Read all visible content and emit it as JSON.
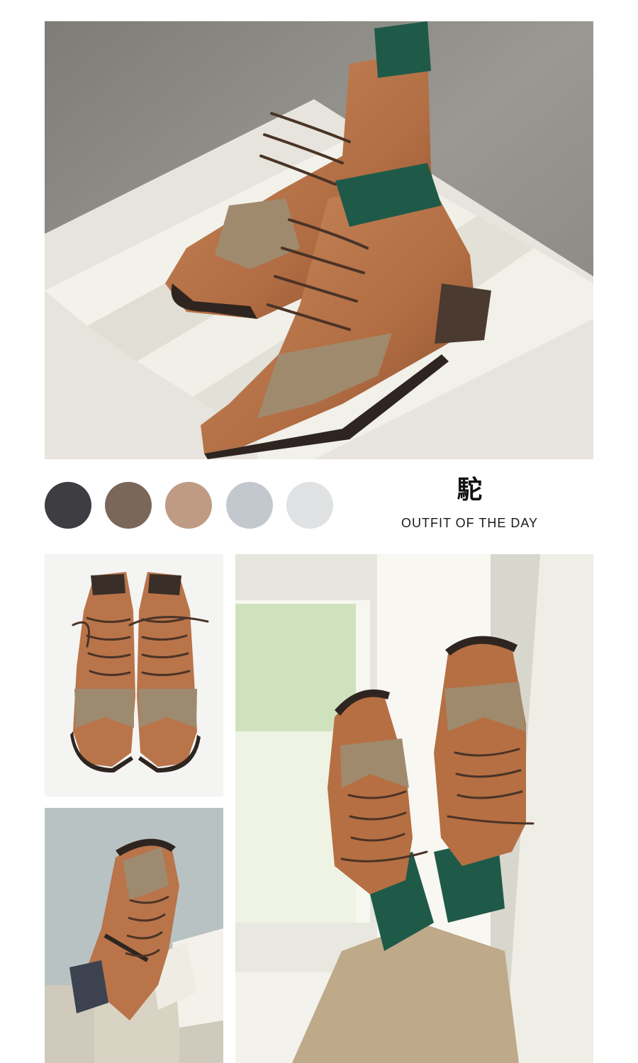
{
  "palette": {
    "swatches": [
      {
        "name": "charcoal",
        "color": "#3e3e42"
      },
      {
        "name": "mocha",
        "color": "#7b6759"
      },
      {
        "name": "tan",
        "color": "#bf9b84"
      },
      {
        "name": "cool-gray",
        "color": "#c3c8cf"
      },
      {
        "name": "light-gray",
        "color": "#dfe1e3"
      }
    ]
  },
  "header": {
    "title_char": "駝",
    "subtitle": "OUTFIT OF THE DAY"
  },
  "colors": {
    "leather": "#b9744a",
    "leather_dark": "#8a4f2d",
    "tweed": "#a08a6e",
    "sock_green": "#1f5a49",
    "lace": "#4a3326",
    "wood_white": "#e9e7df",
    "concrete": "#8d8b85"
  }
}
